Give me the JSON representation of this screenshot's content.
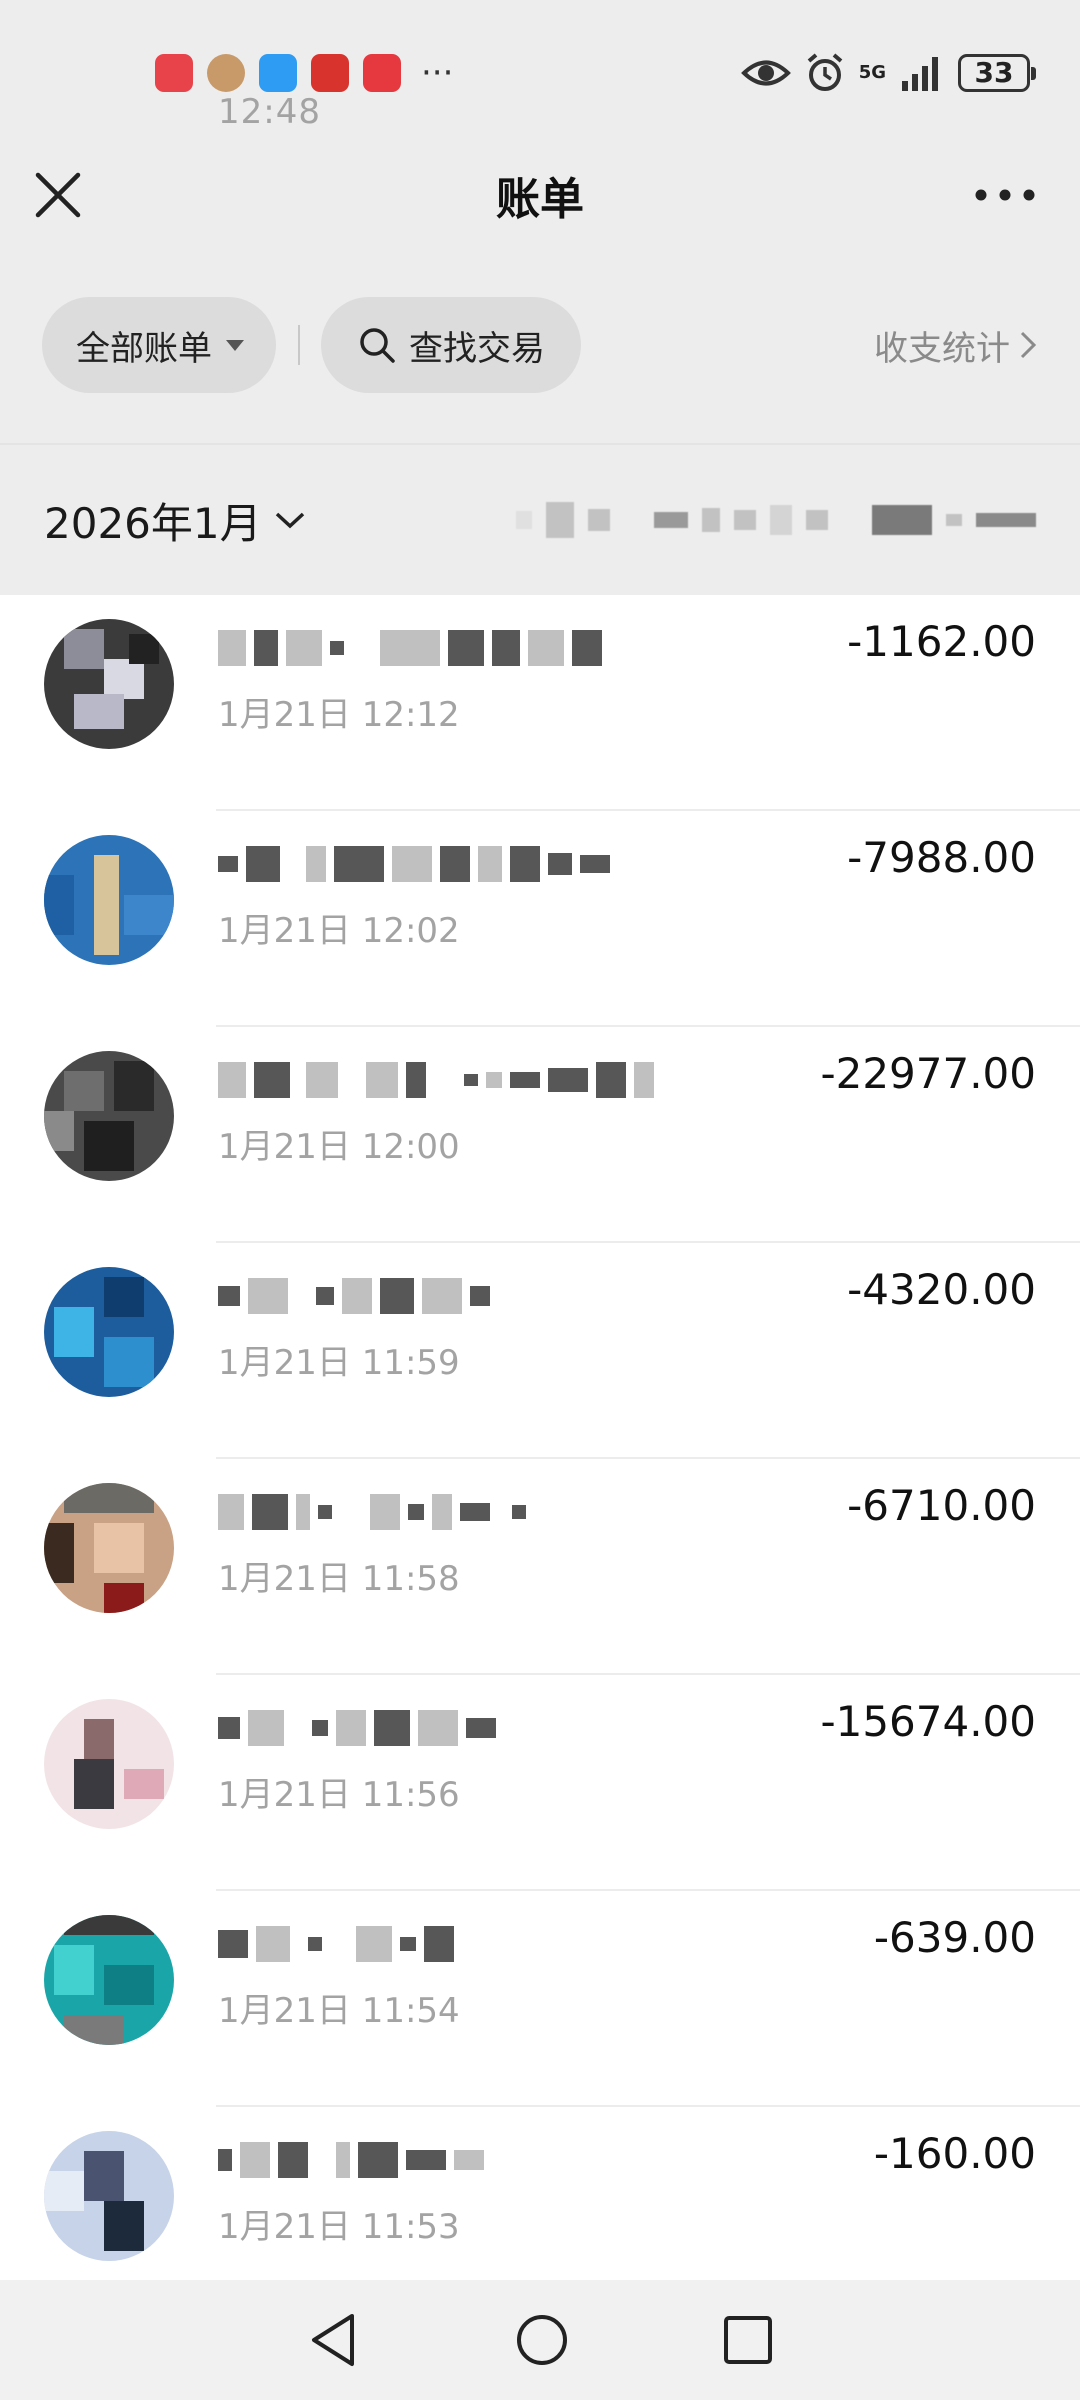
{
  "status_bar": {
    "time": "12:48",
    "network": "5G",
    "battery": "33"
  },
  "header": {
    "title": "账单"
  },
  "filters": {
    "all_bills_label": "全部账单",
    "search_label": "查找交易",
    "stats_label": "收支统计"
  },
  "month": {
    "label": "2026年1月"
  },
  "transactions": [
    {
      "time": "1月21日 12:12",
      "amount": "-1162.00"
    },
    {
      "time": "1月21日 12:02",
      "amount": "-7988.00"
    },
    {
      "time": "1月21日 12:00",
      "amount": "-22977.00"
    },
    {
      "time": "1月21日 11:59",
      "amount": "-4320.00"
    },
    {
      "time": "1月21日 11:58",
      "amount": "-6710.00"
    },
    {
      "time": "1月21日 11:56",
      "amount": "-15674.00"
    },
    {
      "time": "1月21日 11:54",
      "amount": "-639.00"
    },
    {
      "time": "1月21日 11:53",
      "amount": "-160.00"
    }
  ],
  "colors": {
    "background": "#ededed",
    "list_background": "#ffffff",
    "secondary_text": "#a3a3a3"
  }
}
